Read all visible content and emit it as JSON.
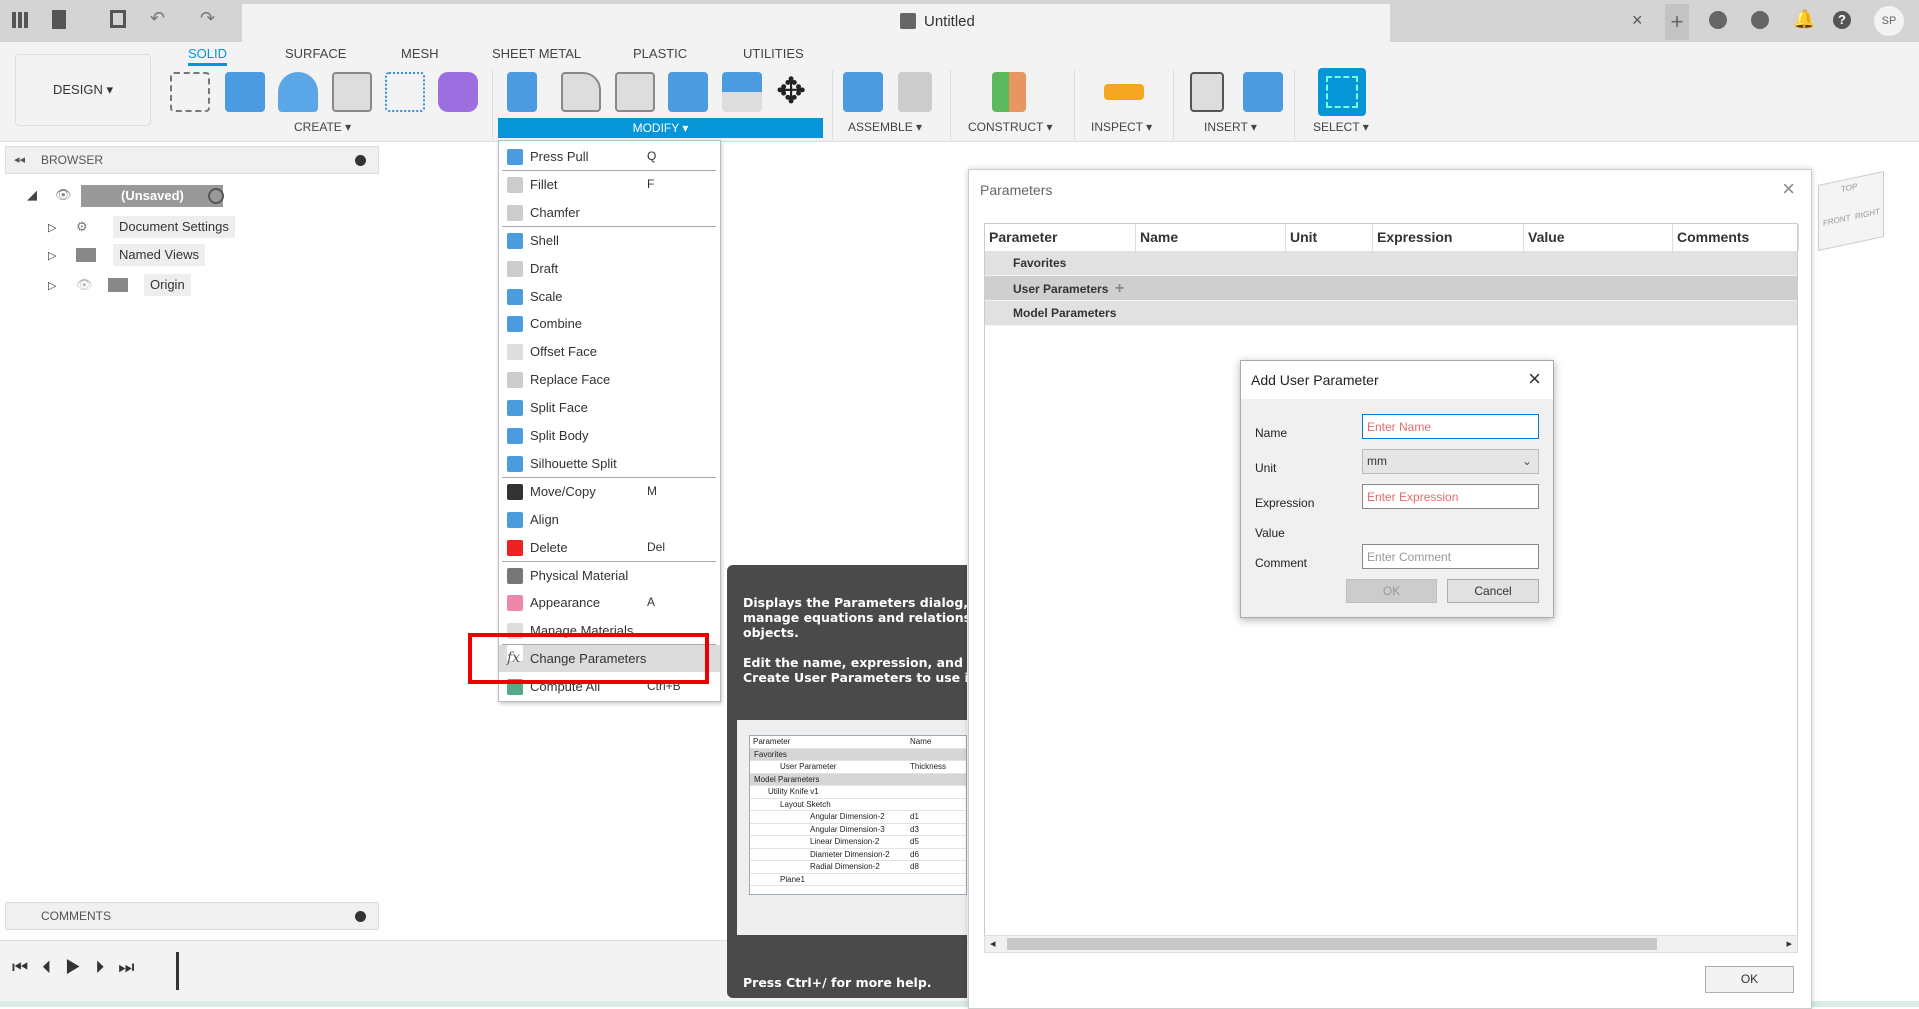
{
  "app": {
    "title": "Untitled",
    "user_initials": "SP"
  },
  "ribbon": {
    "workspace": "DESIGN ▾",
    "tabs": [
      "SOLID",
      "SURFACE",
      "MESH",
      "SHEET METAL",
      "PLASTIC",
      "UTILITIES"
    ],
    "active_tab": "SOLID",
    "groups": [
      "CREATE ▾",
      "MODIFY ▾",
      "ASSEMBLE ▾",
      "CONSTRUCT ▾",
      "INSPECT ▾",
      "INSERT ▾",
      "SELECT ▾"
    ]
  },
  "browser": {
    "header": "BROWSER",
    "items": [
      "(Unsaved)",
      "Document Settings",
      "Named Views",
      "Origin"
    ]
  },
  "comments": {
    "header": "COMMENTS"
  },
  "modify_menu": {
    "items": [
      {
        "label": "Press Pull",
        "shortcut": "Q"
      },
      {
        "label": "Fillet",
        "shortcut": "F"
      },
      {
        "label": "Chamfer",
        "shortcut": ""
      },
      {
        "label": "Shell",
        "shortcut": ""
      },
      {
        "label": "Draft",
        "shortcut": ""
      },
      {
        "label": "Scale",
        "shortcut": ""
      },
      {
        "label": "Combine",
        "shortcut": ""
      },
      {
        "label": "Offset Face",
        "shortcut": ""
      },
      {
        "label": "Replace Face",
        "shortcut": ""
      },
      {
        "label": "Split Face",
        "shortcut": ""
      },
      {
        "label": "Split Body",
        "shortcut": ""
      },
      {
        "label": "Silhouette Split",
        "shortcut": ""
      },
      {
        "label": "Move/Copy",
        "shortcut": "M"
      },
      {
        "label": "Align",
        "shortcut": ""
      },
      {
        "label": "Delete",
        "shortcut": "Del"
      },
      {
        "label": "Physical Material",
        "shortcut": ""
      },
      {
        "label": "Appearance",
        "shortcut": "A"
      },
      {
        "label": "Manage Materials",
        "shortcut": ""
      },
      {
        "label": "Change Parameters",
        "shortcut": ""
      },
      {
        "label": "Compute All",
        "shortcut": "Ctrl+B"
      }
    ],
    "highlighted": "Change Parameters"
  },
  "tooltip": {
    "p1": "Displays the Parameters dialog, wh manage equations and relationships objects.",
    "p2": "Edit the name, expression, and comm Create User Parameters to use in ot",
    "footer": "Press Ctrl+/ for more help.",
    "preview": {
      "headers": [
        "Parameter",
        "Name"
      ],
      "rows": [
        [
          "Favorites",
          ""
        ],
        [
          "User Parameter",
          "Thickness"
        ],
        [
          "Model Parameters",
          ""
        ],
        [
          "Utility Knife v1",
          ""
        ],
        [
          "Layout Sketch",
          ""
        ],
        [
          "Angular Dimension-2",
          "d1"
        ],
        [
          "Angular Dimension-3",
          "d3"
        ],
        [
          "Linear Dimension-2",
          "d5"
        ],
        [
          "Diameter Dimension-2",
          "d6"
        ],
        [
          "Radial Dimension-2",
          "d8"
        ],
        [
          "Plane1",
          ""
        ]
      ]
    }
  },
  "parameters": {
    "title": "Parameters",
    "columns": [
      "Parameter",
      "Name",
      "Unit",
      "Expression",
      "Value",
      "Comments"
    ],
    "rows": [
      "Favorites",
      "User Parameters",
      "Model Parameters"
    ],
    "ok": "OK"
  },
  "add_user_parameter": {
    "title": "Add User Parameter",
    "labels": [
      "Name",
      "Unit",
      "Expression",
      "Value",
      "Comment"
    ],
    "name_placeholder": "Enter Name",
    "unit": "mm",
    "expression_placeholder": "Enter Expression",
    "comment_placeholder": "Enter Comment",
    "ok": "OK",
    "cancel": "Cancel"
  },
  "viewcube": {
    "top": "TOP",
    "front": "FRONT",
    "right": "RIGHT"
  },
  "colors": {
    "accent": "#0696d7",
    "highlight_box": "#e00000",
    "placeholder_red": "#e86a6a"
  }
}
